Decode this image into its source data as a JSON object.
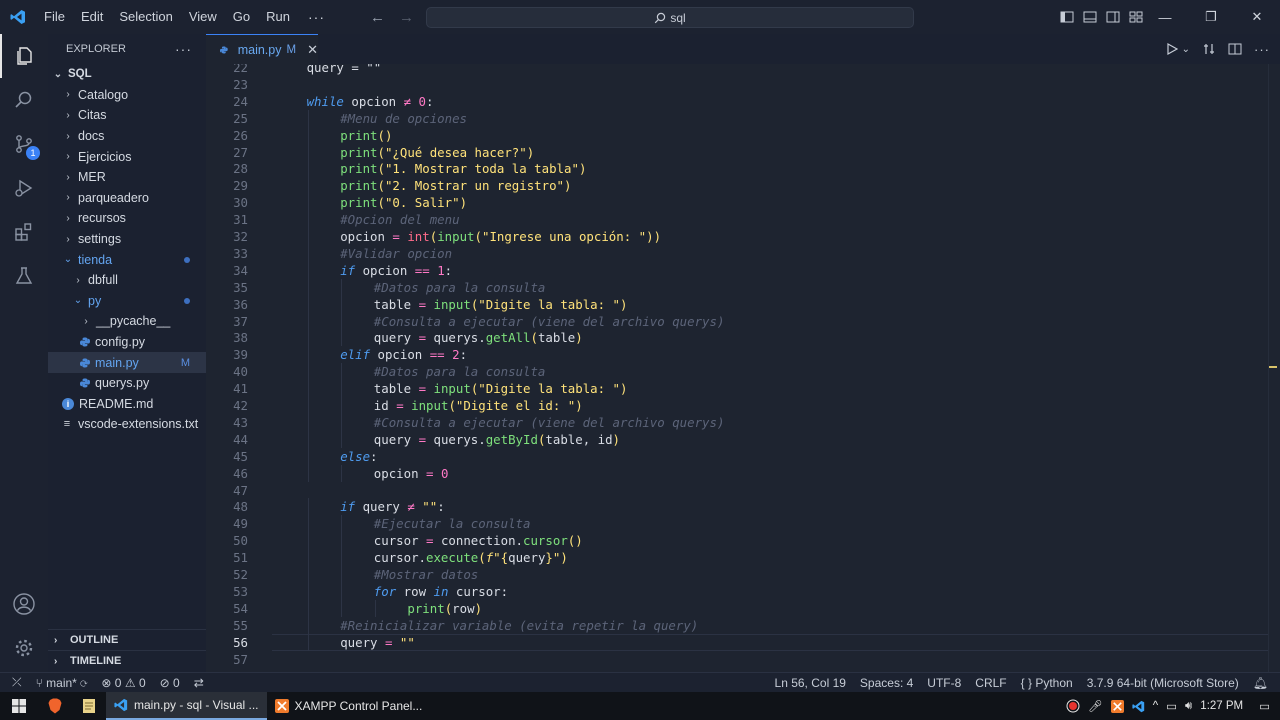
{
  "window": {
    "menu": [
      "File",
      "Edit",
      "Selection",
      "View",
      "Go",
      "Run"
    ],
    "more_menu": "···",
    "command_center": "sql"
  },
  "activity_bar": {
    "icons": [
      "files-icon",
      "search-icon",
      "source-control-icon",
      "run-debug-icon",
      "extensions-icon",
      "testing-icon",
      "account-icon",
      "settings-gear-icon"
    ],
    "source_control_badge": "1"
  },
  "explorer": {
    "title": "EXPLORER",
    "more": "···",
    "root": "SQL",
    "items": [
      {
        "label": "Catalogo",
        "kind": "folder"
      },
      {
        "label": "Citas",
        "kind": "folder"
      },
      {
        "label": "docs",
        "kind": "folder"
      },
      {
        "label": "Ejercicios",
        "kind": "folder"
      },
      {
        "label": "MER",
        "kind": "folder"
      },
      {
        "label": "parqueadero",
        "kind": "folder"
      },
      {
        "label": "recursos",
        "kind": "folder"
      },
      {
        "label": "settings",
        "kind": "folder"
      },
      {
        "label": "tienda",
        "kind": "folder-open"
      },
      {
        "label": "dbfull",
        "kind": "folder"
      },
      {
        "label": "py",
        "kind": "folder-open"
      },
      {
        "label": "__pycache__",
        "kind": "folder"
      },
      {
        "label": "config.py",
        "kind": "python"
      },
      {
        "label": "main.py",
        "kind": "python",
        "mark": "M"
      },
      {
        "label": "querys.py",
        "kind": "python"
      },
      {
        "label": "README.md",
        "kind": "markdown"
      },
      {
        "label": "vscode-extensions.txt",
        "kind": "text"
      }
    ],
    "outline": "OUTLINE",
    "timeline": "TIMELINE"
  },
  "editor": {
    "tab": {
      "name": "main.py",
      "modified": "M"
    },
    "cursor_line": 56,
    "lines": [
      {
        "n": "22",
        "indent": 1,
        "tokens": [
          [
            "pl",
            "query = \"\""
          ]
        ]
      },
      {
        "n": "23",
        "indent": 0,
        "tokens": []
      },
      {
        "n": "24",
        "indent": 1,
        "tokens": [
          [
            "kw",
            "while"
          ],
          [
            "pl",
            " opcion "
          ],
          [
            "op",
            "≠"
          ],
          [
            "pl",
            " "
          ],
          [
            "num",
            "0"
          ],
          [
            "pl",
            ":"
          ]
        ]
      },
      {
        "n": "25",
        "indent": 2,
        "tokens": [
          [
            "cm",
            "#Menu de opciones"
          ]
        ]
      },
      {
        "n": "26",
        "indent": 2,
        "tokens": [
          [
            "fn",
            "print"
          ],
          [
            "br",
            "()"
          ]
        ]
      },
      {
        "n": "27",
        "indent": 2,
        "tokens": [
          [
            "fn",
            "print"
          ],
          [
            "br",
            "("
          ],
          [
            "str",
            "\"¿Qué desea hacer?\""
          ],
          [
            "br",
            ")"
          ]
        ]
      },
      {
        "n": "28",
        "indent": 2,
        "tokens": [
          [
            "fn",
            "print"
          ],
          [
            "br",
            "("
          ],
          [
            "str",
            "\"1. Mostrar toda la tabla\""
          ],
          [
            "br",
            ")"
          ]
        ]
      },
      {
        "n": "29",
        "indent": 2,
        "tokens": [
          [
            "fn",
            "print"
          ],
          [
            "br",
            "("
          ],
          [
            "str",
            "\"2. Mostrar un registro\""
          ],
          [
            "br",
            ")"
          ]
        ]
      },
      {
        "n": "30",
        "indent": 2,
        "tokens": [
          [
            "fn",
            "print"
          ],
          [
            "br",
            "("
          ],
          [
            "str",
            "\"0. Salir\""
          ],
          [
            "br",
            ")"
          ]
        ]
      },
      {
        "n": "31",
        "indent": 2,
        "tokens": [
          [
            "cm",
            "#Opcion del menu"
          ]
        ]
      },
      {
        "n": "32",
        "indent": 2,
        "tokens": [
          [
            "pl",
            "opcion "
          ],
          [
            "op",
            "="
          ],
          [
            "pl",
            " "
          ],
          [
            "bi",
            "int"
          ],
          [
            "br",
            "("
          ],
          [
            "fn",
            "input"
          ],
          [
            "br",
            "("
          ],
          [
            "str",
            "\"Ingrese una opción: \""
          ],
          [
            "br",
            "))"
          ]
        ]
      },
      {
        "n": "33",
        "indent": 2,
        "tokens": [
          [
            "cm",
            "#Validar opcion"
          ]
        ]
      },
      {
        "n": "34",
        "indent": 2,
        "tokens": [
          [
            "kw",
            "if"
          ],
          [
            "pl",
            " opcion "
          ],
          [
            "op",
            "=="
          ],
          [
            "pl",
            " "
          ],
          [
            "num",
            "1"
          ],
          [
            "pl",
            ":"
          ]
        ]
      },
      {
        "n": "35",
        "indent": 3,
        "tokens": [
          [
            "cm",
            "#Datos para la consulta"
          ]
        ]
      },
      {
        "n": "36",
        "indent": 3,
        "tokens": [
          [
            "pl",
            "table "
          ],
          [
            "op",
            "="
          ],
          [
            "pl",
            " "
          ],
          [
            "fn",
            "input"
          ],
          [
            "br",
            "("
          ],
          [
            "str",
            "\"Digite la tabla: \""
          ],
          [
            "br",
            ")"
          ]
        ]
      },
      {
        "n": "37",
        "indent": 3,
        "tokens": [
          [
            "cm",
            "#Consulta a ejecutar (viene del archivo querys)"
          ]
        ]
      },
      {
        "n": "38",
        "indent": 3,
        "tokens": [
          [
            "pl",
            "query "
          ],
          [
            "op",
            "="
          ],
          [
            "pl",
            " querys."
          ],
          [
            "fn",
            "getAll"
          ],
          [
            "br",
            "("
          ],
          [
            "pl",
            "table"
          ],
          [
            "br",
            ")"
          ]
        ]
      },
      {
        "n": "39",
        "indent": 2,
        "tokens": [
          [
            "kw",
            "elif"
          ],
          [
            "pl",
            " opcion "
          ],
          [
            "op",
            "=="
          ],
          [
            "pl",
            " "
          ],
          [
            "num",
            "2"
          ],
          [
            "pl",
            ":"
          ]
        ]
      },
      {
        "n": "40",
        "indent": 3,
        "tokens": [
          [
            "cm",
            "#Datos para la consulta"
          ]
        ]
      },
      {
        "n": "41",
        "indent": 3,
        "tokens": [
          [
            "pl",
            "table "
          ],
          [
            "op",
            "="
          ],
          [
            "pl",
            " "
          ],
          [
            "fn",
            "input"
          ],
          [
            "br",
            "("
          ],
          [
            "str",
            "\"Digite la tabla: \""
          ],
          [
            "br",
            ")"
          ]
        ]
      },
      {
        "n": "42",
        "indent": 3,
        "tokens": [
          [
            "pl",
            "id "
          ],
          [
            "op",
            "="
          ],
          [
            "pl",
            " "
          ],
          [
            "fn",
            "input"
          ],
          [
            "br",
            "("
          ],
          [
            "str",
            "\"Digite el id: \""
          ],
          [
            "br",
            ")"
          ]
        ]
      },
      {
        "n": "43",
        "indent": 3,
        "tokens": [
          [
            "cm",
            "#Consulta a ejecutar (viene del archivo querys)"
          ]
        ]
      },
      {
        "n": "44",
        "indent": 3,
        "tokens": [
          [
            "pl",
            "query "
          ],
          [
            "op",
            "="
          ],
          [
            "pl",
            " querys."
          ],
          [
            "fn",
            "getById"
          ],
          [
            "br",
            "("
          ],
          [
            "pl",
            "table, id"
          ],
          [
            "br",
            ")"
          ]
        ]
      },
      {
        "n": "45",
        "indent": 2,
        "tokens": [
          [
            "kw",
            "else"
          ],
          [
            "pl",
            ":"
          ]
        ]
      },
      {
        "n": "46",
        "indent": 3,
        "tokens": [
          [
            "pl",
            "opcion "
          ],
          [
            "op",
            "="
          ],
          [
            "pl",
            " "
          ],
          [
            "num",
            "0"
          ]
        ]
      },
      {
        "n": "47",
        "indent": 0,
        "tokens": []
      },
      {
        "n": "48",
        "indent": 2,
        "tokens": [
          [
            "kw",
            "if"
          ],
          [
            "pl",
            " query "
          ],
          [
            "op",
            "≠"
          ],
          [
            "pl",
            " "
          ],
          [
            "str",
            "\"\""
          ],
          [
            "pl",
            ":"
          ]
        ]
      },
      {
        "n": "49",
        "indent": 3,
        "tokens": [
          [
            "cm",
            "#Ejecutar la consulta"
          ]
        ]
      },
      {
        "n": "50",
        "indent": 3,
        "tokens": [
          [
            "pl",
            "cursor "
          ],
          [
            "op",
            "="
          ],
          [
            "pl",
            " connection."
          ],
          [
            "fn",
            "cursor"
          ],
          [
            "br",
            "()"
          ]
        ]
      },
      {
        "n": "51",
        "indent": 3,
        "tokens": [
          [
            "pl",
            "cursor."
          ],
          [
            "fn",
            "execute"
          ],
          [
            "br",
            "("
          ],
          [
            "fstr",
            "f"
          ],
          [
            "str",
            "\""
          ],
          [
            "br",
            "{"
          ],
          [
            "pl",
            "query"
          ],
          [
            "br",
            "}"
          ],
          [
            "str",
            "\""
          ],
          [
            "br",
            ")"
          ]
        ]
      },
      {
        "n": "52",
        "indent": 3,
        "tokens": [
          [
            "cm",
            "#Mostrar datos"
          ]
        ]
      },
      {
        "n": "53",
        "indent": 3,
        "tokens": [
          [
            "kw",
            "for"
          ],
          [
            "pl",
            " row "
          ],
          [
            "kw",
            "in"
          ],
          [
            "pl",
            " cursor:"
          ]
        ]
      },
      {
        "n": "54",
        "indent": 4,
        "tokens": [
          [
            "fn",
            "print"
          ],
          [
            "br",
            "("
          ],
          [
            "pl",
            "row"
          ],
          [
            "br",
            ")"
          ]
        ]
      },
      {
        "n": "55",
        "indent": 2,
        "tokens": [
          [
            "cm",
            "#Reinicializar variable (evita repetir la query)"
          ]
        ]
      },
      {
        "n": "56",
        "indent": 2,
        "tokens": [
          [
            "pl",
            "query "
          ],
          [
            "op",
            "="
          ],
          [
            "pl",
            " "
          ],
          [
            "str",
            "\"\""
          ]
        ]
      },
      {
        "n": "57",
        "indent": 0,
        "tokens": []
      }
    ]
  },
  "status_bar": {
    "branch": "main*",
    "problems_errors": "0",
    "problems_warnings": "0",
    "ports": "0",
    "position": "Ln 56, Col 19",
    "spaces": "Spaces: 4",
    "encoding": "UTF-8",
    "eol": "CRLF",
    "language": "Python",
    "interpreter": "3.7.9 64-bit (Microsoft Store)"
  },
  "taskbar": {
    "apps": [
      {
        "label": "main.py - sql - Visual ...",
        "active": true
      },
      {
        "label": "XAMPP Control Panel...",
        "active": false
      }
    ],
    "time": "1:27 PM"
  },
  "colors": {
    "accent": "#3b82f6",
    "editor_bg": "#1e2430",
    "keyword": "#4f9cf0",
    "function": "#7ee07c",
    "string": "#ffe27a",
    "number": "#ff79c6",
    "comment": "#5c6479"
  }
}
